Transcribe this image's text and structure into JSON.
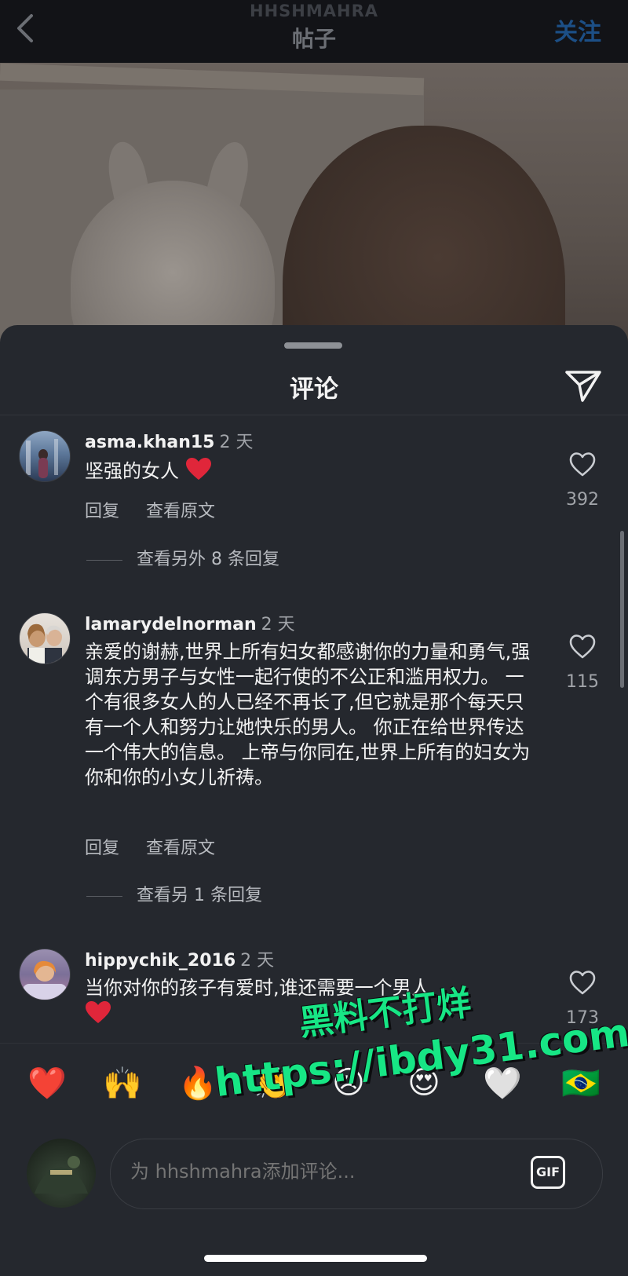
{
  "header": {
    "account_name": "HHSHMAHRA",
    "title": "帖子",
    "follow_label": "关注"
  },
  "sheet": {
    "title": "评论"
  },
  "comments": [
    {
      "username": "asma.khan15",
      "time": "2 天",
      "text": "坚强的女人",
      "likes": "392",
      "reply_label": "回复",
      "translate_label": "查看原文",
      "more_replies": "查看另外 8 条回复"
    },
    {
      "username": "lamarydelnorman",
      "time": "2 天",
      "text": "亲爱的谢赫,世界上所有妇女都感谢你的力量和勇气,强调东方男子与女性一起行使的不公正和滥用权力。 一个有很多女人的人已经不再长了,但它就是那个每天只有一个人和努力让她快乐的男人。 你正在给世界传达一个伟大的信息。 上帝与你同在,世界上所有的妇女为你和你的小女儿祈祷。",
      "likes": "115",
      "reply_label": "回复",
      "translate_label": "查看原文",
      "more_replies": "查看另 1 条回复"
    },
    {
      "username": "hippychik_2016",
      "time": "2 天",
      "text": "当你对你的孩子有爱时,谁还需要一个男人",
      "likes": "173"
    }
  ],
  "quick_emojis": [
    "❤️",
    "🙌",
    "🔥",
    "👏",
    "😢",
    "😍",
    "🤍",
    "🇧🇷"
  ],
  "composer": {
    "placeholder": "为 hhshmahra添加评论...",
    "gif_label": "GIF"
  },
  "watermark": {
    "line1": "黑料不打烊",
    "line2": "https://ibdy31.com"
  },
  "icons": {
    "back": "chevron-left-icon",
    "share": "paper-plane-icon",
    "like": "heart-outline-icon"
  },
  "colors": {
    "background": "#25282e",
    "follow_accent": "#1c4f86",
    "watermark": "#17e685"
  }
}
